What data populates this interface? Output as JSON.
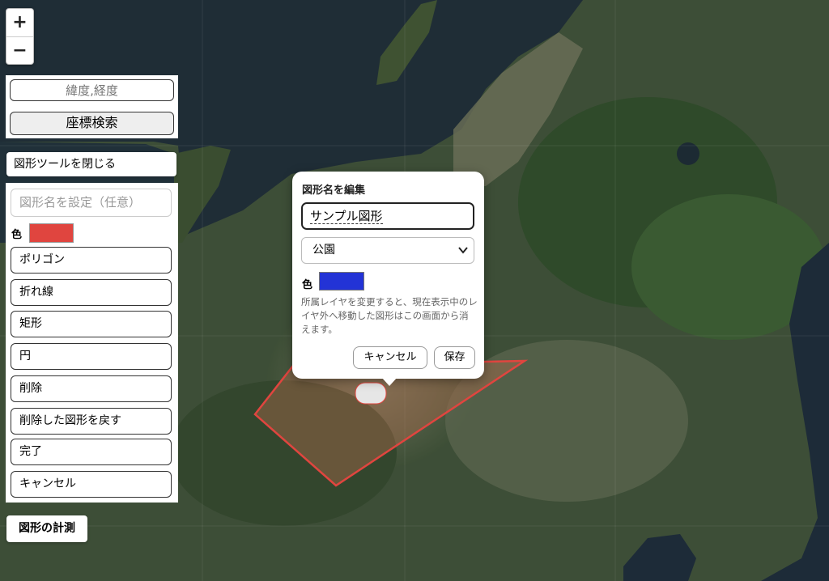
{
  "map": {
    "colors": {
      "land": "#3b4a35",
      "sea": "#1d2b33",
      "polygon_stroke": "#e0453f",
      "polygon_fill": "#a86b4b"
    }
  },
  "zoom": {
    "in_label": "+",
    "out_label": "−"
  },
  "coordinate_search": {
    "placeholder": "緯度,経度",
    "button_label": "座標検索"
  },
  "shape_tools": {
    "close_label": "図形ツールを閉じる",
    "name_placeholder": "図形名を設定（任意）",
    "color_label": "色",
    "color": "#e0453f",
    "buttons": [
      "ポリゴン",
      "折れ線",
      "矩形",
      "円",
      "削除",
      "削除した図形を戻す",
      "完了",
      "キャンセル"
    ]
  },
  "measure_button": "図形の計測",
  "edit_popup": {
    "title": "図形名を編集",
    "name_value": "サンプル図形",
    "layer_selected": "公園",
    "color_label": "色",
    "color": "#2333d6",
    "note": "所属レイヤを変更すると、現在表示中のレイヤ外へ移動した図形はこの画面から消えます。",
    "cancel_label": "キャンセル",
    "save_label": "保存"
  }
}
